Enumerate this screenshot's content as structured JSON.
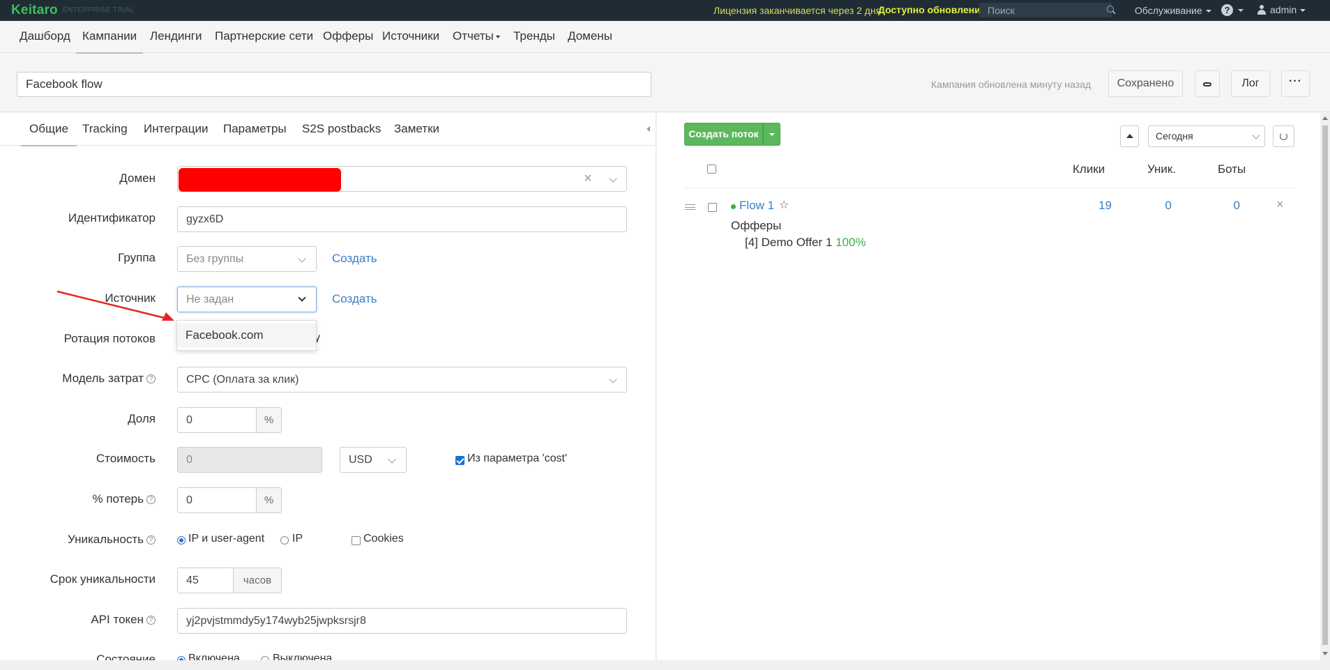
{
  "topbar": {
    "logo": "Keitaro",
    "edition": "ENTERPRISE TRIAL",
    "license": "Лицензия заканчивается через 2 дня",
    "update": "Доступно обновление!",
    "search_placeholder": "Поиск",
    "service": "Обслуживание",
    "help": "?",
    "user": "admin"
  },
  "nav": [
    "Дашборд",
    "Кампании",
    "Лендинги",
    "Партнерские сети",
    "Офферы",
    "Источники",
    "Отчеты",
    "Тренды",
    "Домены"
  ],
  "campaign": {
    "name": "Facebook flow",
    "updated": "Кампания обновлена минуту назад",
    "saved": "Сохранено",
    "log": "Лог",
    "more": "···"
  },
  "tabs": [
    "Общие",
    "Tracking",
    "Интеграции",
    "Параметры",
    "S2S postbacks",
    "Заметки"
  ],
  "form": {
    "domain_label": "Домен",
    "id_label": "Идентификатор",
    "id_value": "gyzx6D",
    "group_label": "Группа",
    "group_value": "Без группы",
    "create": "Создать",
    "source_label": "Источник",
    "source_value": "Не задан",
    "source_option": "Facebook.com",
    "rotation_label": "Ротация потоков",
    "rotation_partial": "у",
    "cost_model_label": "Модель затрат",
    "cost_model_value": "CPC (Оплата за клик)",
    "share_label": "Доля",
    "share_value": "0",
    "percent": "%",
    "cost_label": "Стоимость",
    "cost_value": "0",
    "currency": "USD",
    "cost_param": "Из параметра 'cost'",
    "loss_label": "% потерь",
    "loss_value": "0",
    "uniq_label": "Уникальность",
    "uniq_opt1": "IP и user-agent",
    "uniq_opt2": "IP",
    "uniq_opt3": "Cookies",
    "uniq_period_label": "Срок уникальности",
    "uniq_period_value": "45",
    "hours": "часов",
    "api_label": "API токен",
    "api_value": "yj2pvjstmmdy5y174wyb25jwpksrsjr8",
    "state_label": "Состояние",
    "state_on": "Включена",
    "state_off": "Выключена"
  },
  "flows": {
    "create_flow": "Создать поток",
    "period": "Сегодня",
    "col_clicks": "Клики",
    "col_unique": "Уник.",
    "col_bots": "Боты",
    "rows": [
      {
        "name": "Flow 1",
        "clicks": "19",
        "unique": "0",
        "bots": "0",
        "offers_label": "Офферы",
        "offer": "[4] Demo Offer 1",
        "offer_pct": "100%"
      }
    ]
  }
}
